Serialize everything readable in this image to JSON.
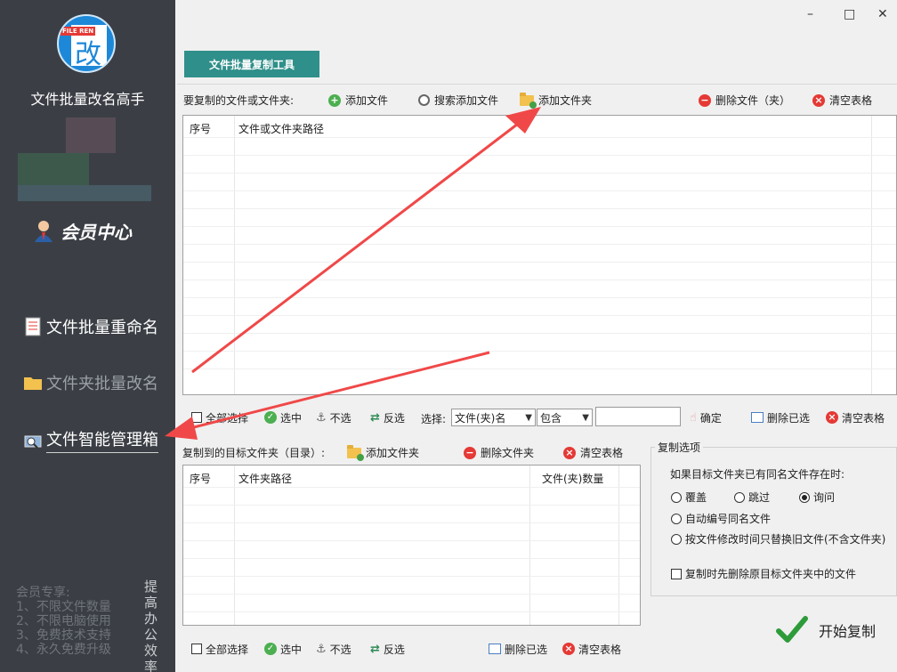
{
  "window": {
    "minimize": "–",
    "maximize": "□",
    "close": "✕"
  },
  "sidebar": {
    "logo_tag": "FILE REN",
    "logo_char": "改",
    "app_title": "文件批量改名高手",
    "member_center": "会员中心",
    "nav": [
      {
        "label": "文件批量重命名"
      },
      {
        "label": "文件夹批量改名"
      },
      {
        "label": "文件智能管理箱"
      }
    ],
    "promo": [
      "会员专享:",
      "1、不限文件数量",
      "2、不限电脑使用",
      "3、免费技术支持",
      "4、永久免费升级"
    ],
    "slogan": "提高办公效率"
  },
  "main": {
    "tool_tab": "文件批量复制工具",
    "source": {
      "label": "要复制的文件或文件夹:",
      "add_file": "添加文件",
      "search_add": "搜索添加文件",
      "add_folder": "添加文件夹",
      "delete": "删除文件（夹）",
      "clear": "清空表格",
      "columns": [
        "序号",
        "文件或文件夹路径"
      ]
    },
    "filter": {
      "select_all": "全部选择",
      "select": "选中",
      "unselect": "不选",
      "invert": "反选",
      "choose_label": "选择:",
      "field_value": "文件(夹)名",
      "mode_value": "包含",
      "confirm": "确定",
      "delete_selected": "删除已选",
      "clear": "清空表格"
    },
    "target": {
      "label": "复制到的目标文件夹（目录）:",
      "add_folder": "添加文件夹",
      "delete_folder": "删除文件夹",
      "clear": "清空表格",
      "columns": [
        "序号",
        "文件夹路径",
        "文件(夹)数量"
      ]
    },
    "bottom": {
      "select_all": "全部选择",
      "select": "选中",
      "unselect": "不选",
      "invert": "反选",
      "delete_selected": "删除已选",
      "clear": "清空表格"
    },
    "options": {
      "title": "复制选项",
      "question": "如果目标文件夹已有同名文件存在时:",
      "overwrite": "覆盖",
      "skip": "跳过",
      "ask": "询问",
      "auto_number": "自动编号同名文件",
      "replace_older": "按文件修改时间只替换旧文件(不含文件夹)",
      "delete_before": "复制时先删除原目标文件夹中的文件"
    },
    "start": "开始复制"
  },
  "colors": {
    "sidebar": "#3b3f45",
    "accent": "#2f8f8a",
    "arrow": "#f04848"
  }
}
